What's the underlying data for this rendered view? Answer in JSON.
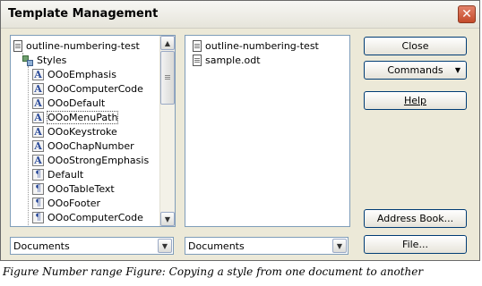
{
  "dialog": {
    "title": "Template Management",
    "close_glyph": "✕"
  },
  "left_panel": {
    "root": "outline-numbering-test",
    "group": "Styles",
    "items": [
      {
        "label": "OOoEmphasis",
        "icon": "character-style-icon"
      },
      {
        "label": "OOoComputerCode",
        "icon": "character-style-icon"
      },
      {
        "label": "OOoDefault",
        "icon": "character-style-icon"
      },
      {
        "label": "OOoMenuPath",
        "icon": "character-style-icon",
        "selected": true
      },
      {
        "label": "OOoKeystroke",
        "icon": "character-style-icon"
      },
      {
        "label": "OOoChapNumber",
        "icon": "character-style-icon"
      },
      {
        "label": "OOoStrongEmphasis",
        "icon": "character-style-icon"
      },
      {
        "label": "Default",
        "icon": "paragraph-style-icon"
      },
      {
        "label": "OOoTableText",
        "icon": "paragraph-style-icon"
      },
      {
        "label": "OOoFooter",
        "icon": "paragraph-style-icon"
      },
      {
        "label": "OOoComputerCode",
        "icon": "paragraph-style-icon"
      }
    ],
    "glyph_char": "A",
    "glyph_para": "¶",
    "scroll_up": "▲",
    "scroll_down": "▼",
    "combo_value": "Documents"
  },
  "right_panel": {
    "items": [
      {
        "label": "outline-numbering-test",
        "icon": "document-icon"
      },
      {
        "label": "sample.odt",
        "icon": "document-icon"
      }
    ],
    "combo_value": "Documents"
  },
  "buttons": {
    "close": "Close",
    "commands": "Commands",
    "commands_arrow": "▼",
    "help": "Help",
    "address_book": "Address Book...",
    "file": "File..."
  },
  "combo_arrow": "▼",
  "caption": "Figure Number range Figure: Copying a style from one document to another"
}
